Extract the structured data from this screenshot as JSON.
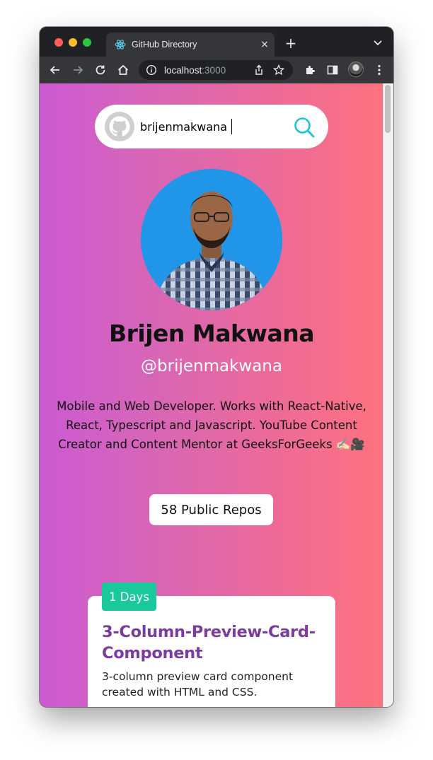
{
  "browser": {
    "tab_title": "GitHub Directory",
    "tab_close": "×",
    "new_tab": "+",
    "url_host": "localhost",
    "url_port": ":3000"
  },
  "search": {
    "value": "brijenmakwana"
  },
  "profile": {
    "name": "Brijen Makwana",
    "login": "@brijenmakwana",
    "bio": "Mobile and Web Developer. Works with React-Native, React, Typescript and Javascript. YouTube Content Creator and Content Mentor at GeeksForGeeks ✍🏻🎥",
    "public_repos_label": "58 Public Repos"
  },
  "repos": [
    {
      "age_label": "1 Days",
      "title": "3-Column-Preview-Card-Component",
      "description": "3-column preview card component created with HTML and CSS."
    }
  ],
  "colors": {
    "gradient_left": "#cc5ad3",
    "gradient_right": "#ff737c",
    "repo_title": "#7c3c9e",
    "days_badge": "#19c99b",
    "search_icon": "#22c1d6"
  },
  "icons": {
    "tab_favicon": "react-icon",
    "search": "search-icon",
    "github": "github-icon"
  }
}
